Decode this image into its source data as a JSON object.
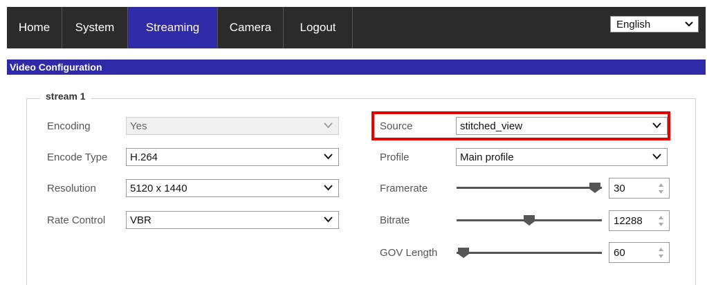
{
  "nav": {
    "items": [
      {
        "label": "Home",
        "active": false
      },
      {
        "label": "System",
        "active": false
      },
      {
        "label": "Streaming",
        "active": true
      },
      {
        "label": "Camera",
        "active": false
      },
      {
        "label": "Logout",
        "active": false
      }
    ],
    "language": "English"
  },
  "section": {
    "title": "Video Configuration",
    "stream_title": "stream 1"
  },
  "left_fields": {
    "encoding": {
      "label": "Encoding",
      "value": "Yes"
    },
    "encode_type": {
      "label": "Encode Type",
      "value": "H.264"
    },
    "resolution": {
      "label": "Resolution",
      "value": "5120 x 1440"
    },
    "rate_control": {
      "label": "Rate Control",
      "value": "VBR"
    }
  },
  "right_fields": {
    "source": {
      "label": "Source",
      "value": "stitched_view"
    },
    "profile": {
      "label": "Profile",
      "value": "Main profile"
    },
    "framerate": {
      "label": "Framerate",
      "value": "30",
      "level": 1.0
    },
    "bitrate": {
      "label": "Bitrate",
      "value": "12288",
      "level": 0.5
    },
    "gov_length": {
      "label": "GOV Length",
      "value": "60",
      "level": 0.0
    }
  },
  "colors": {
    "nav_bg": "#2b2b2b",
    "accent": "#2f2aa8",
    "highlight": "#e60000"
  }
}
